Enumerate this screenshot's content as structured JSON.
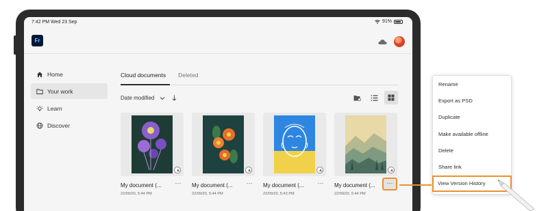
{
  "status_bar": {
    "time": "7:42 PM  Wed 23 Sep",
    "battery": "91%"
  },
  "app": {
    "logo": "Fr",
    "cloud_icon": "cloud-icon"
  },
  "sidebar": {
    "items": [
      {
        "label": "Home",
        "icon": "home-icon"
      },
      {
        "label": "Your work",
        "icon": "folder-icon",
        "active": true
      },
      {
        "label": "Learn",
        "icon": "lightbulb-icon"
      },
      {
        "label": "Discover",
        "icon": "globe-icon"
      }
    ]
  },
  "tabs": [
    {
      "label": "Cloud documents",
      "active": true
    },
    {
      "label": "Deleted",
      "active": false
    }
  ],
  "sort": {
    "label": "Date modified"
  },
  "documents": [
    {
      "title": "My document (...",
      "date": "22/09/20, 5:44 PM",
      "art": "purple-flowers"
    },
    {
      "title": "My document (...",
      "date": "22/09/20, 5:44 PM",
      "art": "orange-flowers"
    },
    {
      "title": "My document (...",
      "date": "22/09/20, 5:43 PM",
      "art": "face-sketch"
    },
    {
      "title": "My document (...",
      "date": "22/09/20, 5:44 PM",
      "art": "mountain-landscape"
    }
  ],
  "context_menu": {
    "items": [
      "Rename",
      "Export as PSD",
      "Duplicate",
      "Make available offline",
      "Delete",
      "Share link",
      "View Version History"
    ],
    "highlighted": "View Version History"
  },
  "colors": {
    "highlight": "#e8912c",
    "logo_bg": "#001834",
    "logo_text": "#7fc4ff"
  }
}
